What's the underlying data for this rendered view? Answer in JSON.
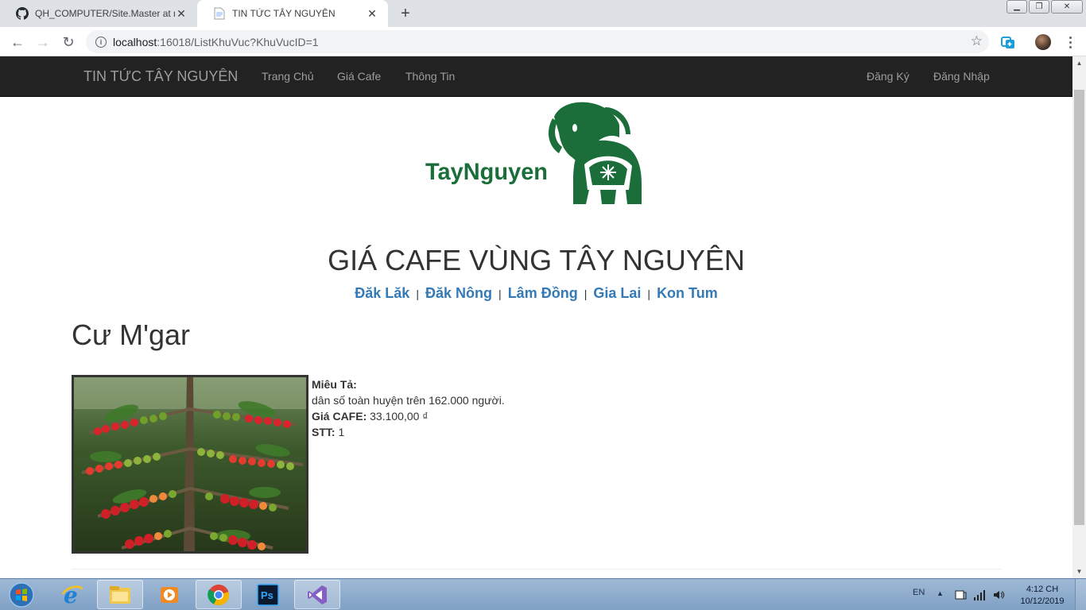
{
  "browser": {
    "tabs": [
      {
        "title": "QH_COMPUTER/Site.Master at m",
        "icon": "github-icon",
        "active": false
      },
      {
        "title": "TIN TỨC TÂY NGUYÊN",
        "icon": "page-icon",
        "active": true
      }
    ],
    "url_host": "localhost",
    "url_rest": ":16018/ListKhuVuc?KhuVucID=1"
  },
  "navbar": {
    "brand": "TIN TỨC TÂY NGUYÊN",
    "links": [
      "Trang Chủ",
      "Giá Cafe",
      "Thông Tin"
    ],
    "register": "Đăng Ký",
    "login": "Đăng Nhập"
  },
  "logo": {
    "text": "TayNguyen",
    "color": "#1b6e3a"
  },
  "page": {
    "title": "GIÁ CAFE VÙNG TÂY NGUYÊN",
    "regions": [
      "Đăk Lăk",
      "Đăk Nông",
      "Lâm Đồng",
      "Gia Lai",
      "Kon Tum"
    ],
    "separator": "|",
    "area_heading": "Cư M'gar"
  },
  "details": {
    "description_label": "Miêu Tả:",
    "description": "dân số toàn huyện trên 162.000 người.",
    "price_label": "Giá CAFE:",
    "price": "33.100,00 ₫",
    "stt_label": "STT:",
    "stt": "1"
  },
  "taskbar": {
    "lang": "EN",
    "time": "4:12 CH",
    "date": "10/12/2019"
  },
  "colors": {
    "navbar_bg": "#222222",
    "link": "#337ab7",
    "logo_green": "#1b6e3a"
  }
}
